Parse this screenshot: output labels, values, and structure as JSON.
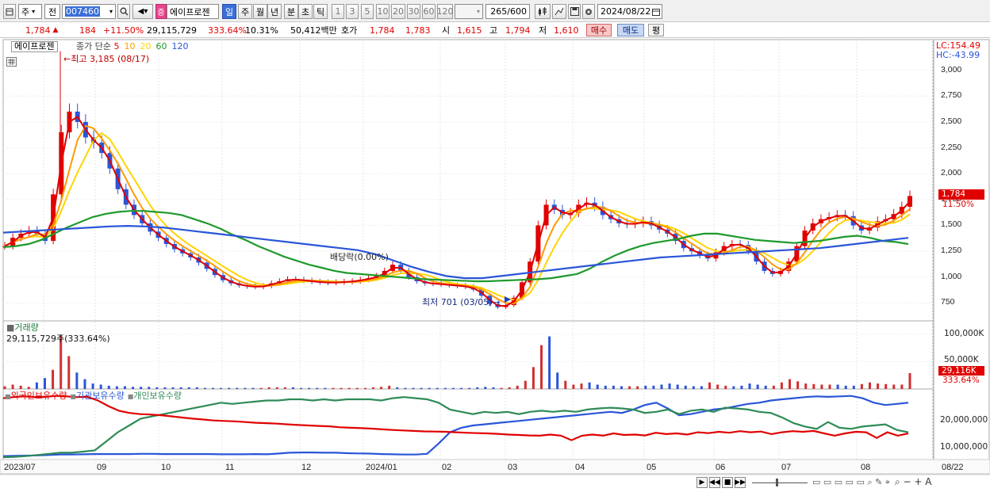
{
  "toolbar": {
    "market": "주",
    "mode": "전",
    "code": "007460",
    "name": "에이프로젠",
    "name_badge": "증",
    "periods": [
      "일",
      "주",
      "월",
      "년",
      "분",
      "초",
      "틱"
    ],
    "intervals": [
      "1",
      "3",
      "5",
      "10",
      "20",
      "30",
      "60",
      "120"
    ],
    "count": "265",
    "count_max": "/600",
    "date": "2024/08/22"
  },
  "info": {
    "price": "1,784",
    "change": "184",
    "change_pct": "+11.50%",
    "volume": "29,115,729",
    "vol_ratio": "333.64%",
    "turnover_pct": "10.31%",
    "amount": "50,412백만",
    "quote_label": "호가",
    "ask": "1,784",
    "bid": "1,783",
    "open_label": "시",
    "open": "1,615",
    "high_label": "고",
    "high": "1,794",
    "low_label": "저",
    "low": "1,610",
    "buy": "매수",
    "sell": "매도",
    "avg": "평"
  },
  "price_panel": {
    "stock": "에이프로젠",
    "legend_prefix": "종가 단순",
    "mas": [
      {
        "label": "5",
        "color": "#e00000"
      },
      {
        "label": "10",
        "color": "#ff9a00"
      },
      {
        "label": "20",
        "color": "#ffd400"
      },
      {
        "label": "60",
        "color": "#1e9a2c"
      },
      {
        "label": "120",
        "color": "#2a55d8"
      }
    ],
    "lc": "LC:154.49",
    "hc": "HC:-43.99",
    "high_note": "최고 3,185 (08/17)",
    "low_note": "최저 701 (03/05)",
    "dividend": "배당락(0.00%)",
    "yticks": [
      "3,000",
      "2,750",
      "2,500",
      "2,250",
      "2,000",
      "1,750",
      "1,500",
      "1,250",
      "1,000",
      "750"
    ],
    "last_price": "1,784",
    "last_pct": "11.50%"
  },
  "volume_panel": {
    "title": "거래량",
    "value": "29,115,729주(333.64%)",
    "yticks": [
      "100,000K",
      "50,000K"
    ],
    "last": "29,116K",
    "last_pct": "333.64%"
  },
  "holding_panel": {
    "series": [
      {
        "name": "외국인보유수량",
        "color": "#e00000"
      },
      {
        "name": "기관보유수량",
        "color": "#2a55d8"
      },
      {
        "name": "개인보유수량",
        "color": "#2e8b57"
      }
    ],
    "yticks": [
      "20,000,000",
      "10,000,000"
    ]
  },
  "xaxis": [
    "2023/07",
    "09",
    "10",
    "11",
    "12",
    "2024/01",
    "02",
    "03",
    "04",
    "05",
    "06",
    "07",
    "08",
    "08/22"
  ],
  "chart_data": {
    "type": "candlestick",
    "price_range": [
      600,
      3250
    ],
    "volume_range": [
      0,
      120000
    ],
    "holdings_range": [
      0,
      30000000
    ],
    "price_series": [
      1300,
      1380,
      1420,
      1450,
      1420,
      1350,
      1800,
      2400,
      2600,
      2500,
      2350,
      2300,
      2200,
      2050,
      1850,
      1700,
      1600,
      1520,
      1440,
      1380,
      1320,
      1270,
      1230,
      1190,
      1140,
      1080,
      1020,
      970,
      940,
      920,
      910,
      905,
      915,
      940,
      960,
      980,
      975,
      965,
      955,
      950,
      945,
      950,
      955,
      960,
      975,
      990,
      1010,
      1060,
      1120,
      1060,
      1000,
      960,
      940,
      935,
      930,
      920,
      915,
      905,
      880,
      820,
      740,
      710,
      730,
      800,
      950,
      1150,
      1500,
      1700,
      1650,
      1600,
      1620,
      1700,
      1720,
      1680,
      1600,
      1560,
      1520,
      1510,
      1520,
      1540,
      1500,
      1460,
      1420,
      1350,
      1280,
      1250,
      1210,
      1180,
      1240,
      1300,
      1320,
      1310,
      1250,
      1150,
      1060,
      1030,
      1060,
      1150,
      1300,
      1450,
      1520,
      1560,
      1580,
      1600,
      1590,
      1500,
      1450,
      1480,
      1540,
      1560,
      1610,
      1680,
      1784
    ],
    "ma60": [
      1290,
      1300,
      1320,
      1360,
      1420,
      1480,
      1530,
      1580,
      1610,
      1630,
      1640,
      1640,
      1630,
      1620,
      1600,
      1560,
      1520,
      1470,
      1410,
      1360,
      1300,
      1250,
      1200,
      1160,
      1120,
      1090,
      1060,
      1040,
      1030,
      1020,
      1010,
      1000,
      990,
      980,
      975,
      970,
      965,
      960,
      960,
      965,
      970,
      975,
      980,
      990,
      1010,
      1030,
      1080,
      1150,
      1210,
      1260,
      1300,
      1330,
      1350,
      1370,
      1400,
      1420,
      1420,
      1400,
      1380,
      1360,
      1350,
      1340,
      1330,
      1340,
      1350,
      1370,
      1390,
      1400,
      1380,
      1350,
      1340,
      1320
    ],
    "ma120": [
      1430,
      1440,
      1450,
      1460,
      1470,
      1480,
      1490,
      1495,
      1490,
      1480,
      1460,
      1440,
      1420,
      1400,
      1380,
      1360,
      1340,
      1320,
      1300,
      1280,
      1260,
      1220,
      1160,
      1100,
      1050,
      1010,
      990,
      990,
      1010,
      1030,
      1050,
      1070,
      1090,
      1110,
      1130,
      1150,
      1170,
      1190,
      1200,
      1210,
      1220,
      1230,
      1240,
      1250,
      1260,
      1270,
      1280,
      1300,
      1320,
      1340,
      1360,
      1380
    ],
    "volume": [
      5,
      8,
      6,
      4,
      12,
      20,
      35,
      98,
      60,
      30,
      18,
      10,
      8,
      6,
      5,
      5,
      4,
      4,
      4,
      3,
      3,
      3,
      3,
      3,
      3,
      2,
      2,
      2,
      2,
      2,
      2,
      2,
      2,
      3,
      3,
      3,
      3,
      2,
      2,
      2,
      2,
      2,
      2,
      2,
      2,
      2,
      3,
      4,
      6,
      3,
      2,
      2,
      2,
      2,
      2,
      2,
      2,
      2,
      2,
      3,
      4,
      3,
      2,
      3,
      6,
      15,
      40,
      80,
      96,
      30,
      15,
      8,
      10,
      12,
      8,
      6,
      6,
      5,
      5,
      5,
      6,
      6,
      8,
      10,
      8,
      6,
      5,
      5,
      12,
      8,
      6,
      5,
      6,
      10,
      8,
      6,
      6,
      12,
      18,
      14,
      10,
      9,
      8,
      8,
      8,
      6,
      6,
      9,
      12,
      10,
      9,
      8,
      8,
      29
    ],
    "foreign": [
      27,
      27.5,
      27.8,
      27.5,
      27.6,
      28,
      27.8,
      27.5,
      27.6,
      26,
      23.5,
      21.5,
      20.5,
      20,
      19.8,
      19.5,
      19,
      18.5,
      18,
      17.6,
      17.2,
      17,
      16.8,
      16.5,
      16.2,
      16,
      15.8,
      15.5,
      15.2,
      15,
      14.8,
      14.6,
      14.2,
      14,
      13.8,
      13.6,
      13.3,
      13,
      12.8,
      12.6,
      12.4,
      12.3,
      12.2,
      12,
      11.8,
      11.6,
      11.5,
      11.3,
      11,
      10.8,
      10.6,
      10.5,
      11,
      10.5,
      8.5,
      10.5,
      11,
      10.5,
      11.5,
      10.8,
      11,
      10.6,
      11.8,
      11.2,
      11.5,
      11,
      12,
      11.6,
      12.2,
      11.8,
      12.5,
      12,
      12.3,
      11.2,
      12,
      12.5,
      12.2,
      12.6,
      11.5,
      10.5,
      11.5,
      12.2,
      12,
      9.5,
      12,
      10.5,
      11.5
    ],
    "institution": [
      1.5,
      1.6,
      1.7,
      1.8,
      2,
      2.2,
      2.2,
      2.3,
      2.4,
      2.4,
      2.4,
      2.4,
      2.5,
      2.5,
      2.4,
      2.4,
      2.4,
      2.4,
      2.4,
      2.3,
      2.3,
      2.3,
      2.4,
      2.3,
      2.6,
      3,
      3.1,
      3.1,
      3,
      3,
      2.8,
      2.7,
      2.6,
      2.4,
      2.3,
      2.2,
      2.2,
      2.5,
      7,
      12,
      14,
      15,
      15.5,
      16,
      16.5,
      17,
      17.5,
      18,
      18.5,
      19,
      19.5,
      20,
      20.5,
      21,
      20.5,
      22,
      24,
      25,
      22.5,
      19.5,
      20,
      21,
      22,
      22.5,
      23.5,
      24.5,
      25,
      26,
      26.5,
      27,
      27.5,
      27.8,
      27.6,
      27.8,
      28,
      27,
      25,
      24,
      24.5,
      25
    ],
    "individual": [
      1,
      1.2,
      1.5,
      2,
      2.5,
      3,
      3,
      3.5,
      4,
      8,
      12,
      15,
      18,
      19,
      20,
      21,
      22,
      23,
      24,
      25,
      24.5,
      25,
      25.5,
      26,
      26,
      26.5,
      26.5,
      26,
      26.5,
      26,
      26.5,
      26.5,
      26.5,
      26,
      27,
      27.5,
      27,
      26.5,
      25,
      22,
      21,
      20,
      21,
      20.5,
      21,
      20,
      21,
      21.5,
      21,
      21.5,
      21,
      22,
      22.5,
      22.8,
      22.5,
      22,
      20.5,
      21,
      22,
      20,
      21.5,
      22,
      21,
      22.8,
      22.5,
      22,
      21,
      20.5,
      18.5,
      16,
      14.5,
      13.5,
      16.5,
      14,
      13.5,
      14.5,
      15,
      15.5,
      13,
      12
    ]
  }
}
